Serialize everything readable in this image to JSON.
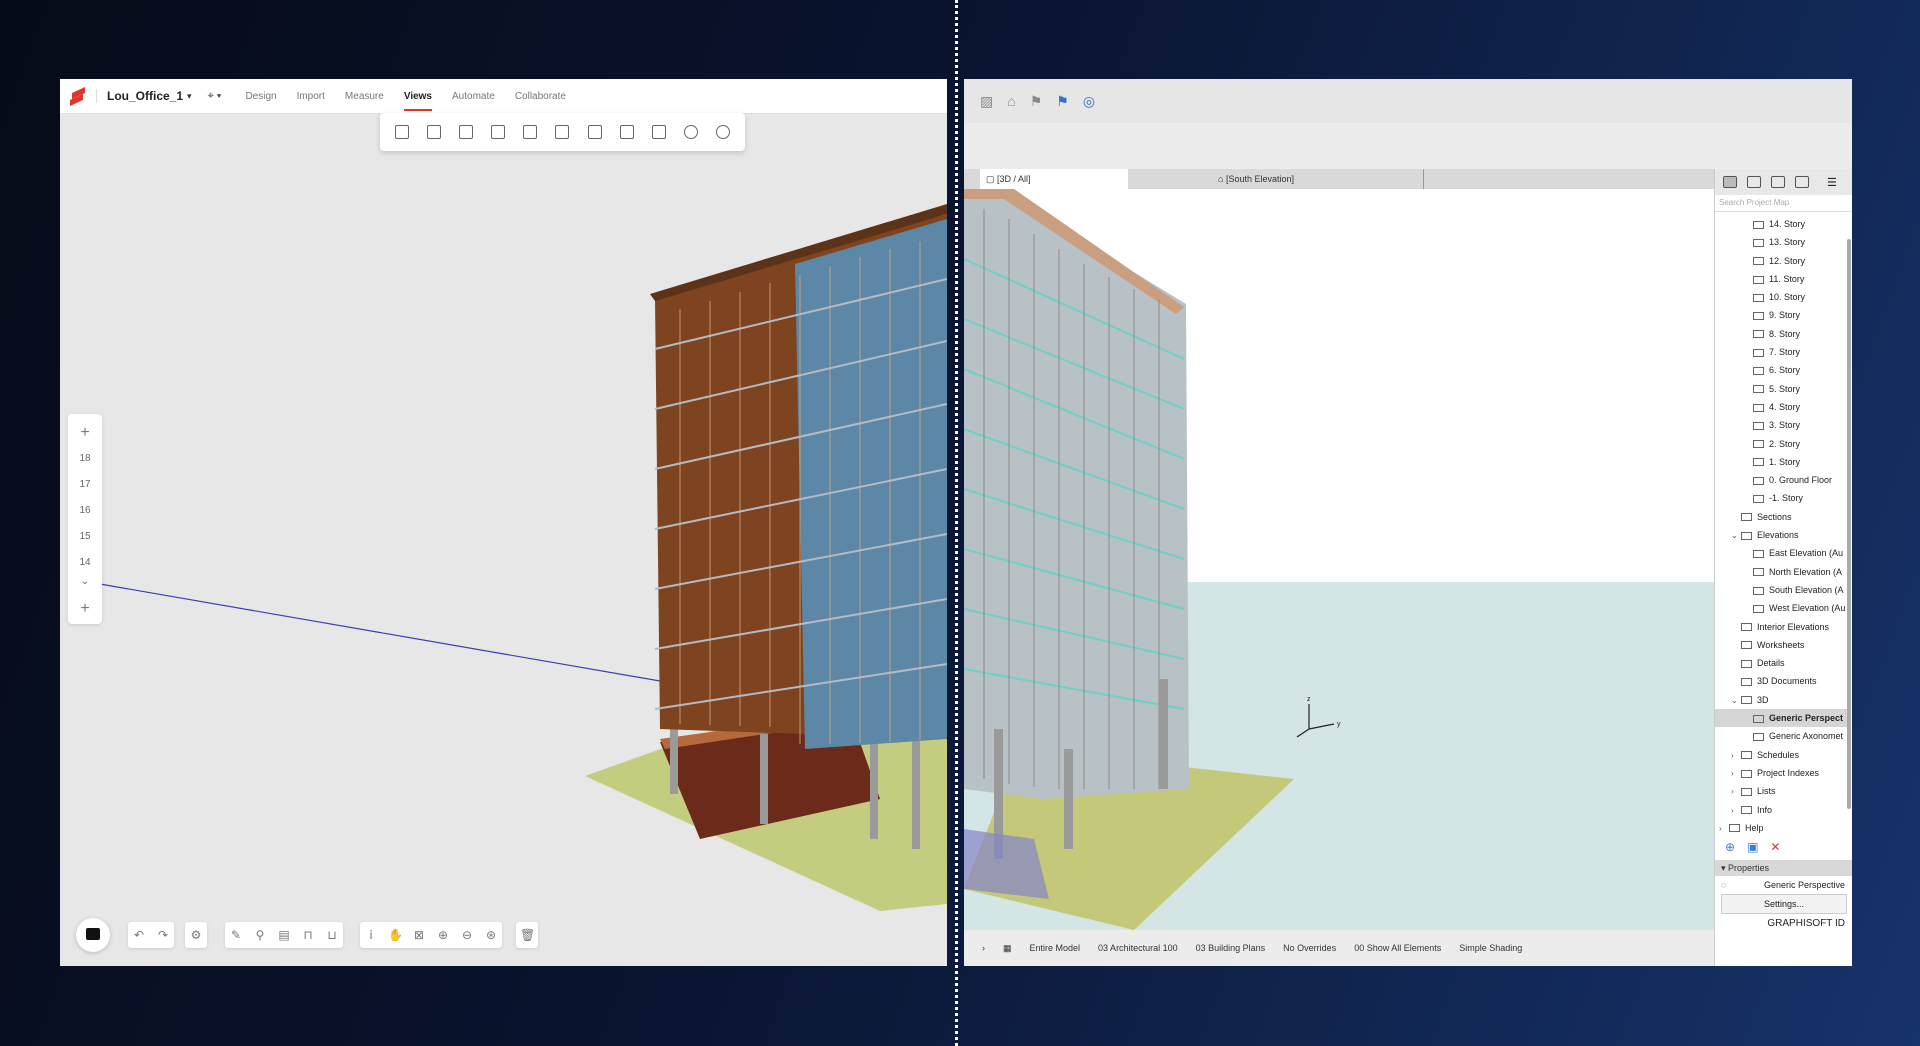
{
  "left_app": {
    "project_name": "Lou_Office_1",
    "nav_tabs": [
      "Design",
      "Import",
      "Measure",
      "Views",
      "Automate",
      "Collaborate"
    ],
    "active_tab": "Views",
    "story_levels": [
      "18",
      "17",
      "16",
      "15",
      "14"
    ]
  },
  "right_app": {
    "tab_3d": "[3D / All]",
    "tab_elevation": "[South Elevation]",
    "search_placeholder": "Search Project Map",
    "tree": [
      {
        "label": "14. Story",
        "indent": 2,
        "type": "story"
      },
      {
        "label": "13. Story",
        "indent": 2,
        "type": "story"
      },
      {
        "label": "12. Story",
        "indent": 2,
        "type": "story"
      },
      {
        "label": "11. Story",
        "indent": 2,
        "type": "story"
      },
      {
        "label": "10. Story",
        "indent": 2,
        "type": "story"
      },
      {
        "label": "9. Story",
        "indent": 2,
        "type": "story"
      },
      {
        "label": "8. Story",
        "indent": 2,
        "type": "story"
      },
      {
        "label": "7. Story",
        "indent": 2,
        "type": "story"
      },
      {
        "label": "6. Story",
        "indent": 2,
        "type": "story"
      },
      {
        "label": "5. Story",
        "indent": 2,
        "type": "story"
      },
      {
        "label": "4. Story",
        "indent": 2,
        "type": "story"
      },
      {
        "label": "3. Story",
        "indent": 2,
        "type": "story"
      },
      {
        "label": "2. Story",
        "indent": 2,
        "type": "story"
      },
      {
        "label": "1. Story",
        "indent": 2,
        "type": "story"
      },
      {
        "label": "0. Ground Floor",
        "indent": 2,
        "type": "story"
      },
      {
        "label": "-1. Story",
        "indent": 2,
        "type": "story"
      },
      {
        "label": "Sections",
        "indent": 1,
        "type": "folder"
      },
      {
        "label": "Elevations",
        "indent": 1,
        "type": "folder",
        "expanded": true
      },
      {
        "label": "East Elevation (Au",
        "indent": 2,
        "type": "view"
      },
      {
        "label": "North Elevation (A",
        "indent": 2,
        "type": "view"
      },
      {
        "label": "South Elevation (A",
        "indent": 2,
        "type": "view"
      },
      {
        "label": "West Elevation (Au",
        "indent": 2,
        "type": "view"
      },
      {
        "label": "Interior Elevations",
        "indent": 1,
        "type": "folder"
      },
      {
        "label": "Worksheets",
        "indent": 1,
        "type": "folder"
      },
      {
        "label": "Details",
        "indent": 1,
        "type": "folder"
      },
      {
        "label": "3D Documents",
        "indent": 1,
        "type": "folder"
      },
      {
        "label": "3D",
        "indent": 1,
        "type": "folder",
        "expanded": true
      },
      {
        "label": "Generic Perspect",
        "indent": 2,
        "type": "view",
        "selected": true
      },
      {
        "label": "Generic Axonomet",
        "indent": 2,
        "type": "view"
      },
      {
        "label": "Schedules",
        "indent": 1,
        "type": "folder",
        "collapsed": true
      },
      {
        "label": "Project Indexes",
        "indent": 1,
        "type": "folder",
        "collapsed": true
      },
      {
        "label": "Lists",
        "indent": 1,
        "type": "folder",
        "collapsed": true
      },
      {
        "label": "Info",
        "indent": 1,
        "type": "folder",
        "collapsed": true
      },
      {
        "label": "Help",
        "indent": 0,
        "type": "folder",
        "collapsed": true
      }
    ],
    "properties_label": "Properties",
    "properties_value": "Generic Perspective",
    "settings_label": "Settings...",
    "brand": "GRAPHISOFT ID",
    "status": {
      "model": "Entire Model",
      "layer": "03 Architectural 100",
      "plans": "03 Building Plans",
      "overrides": "No Overrides",
      "elements": "00 Show All Elements",
      "shading": "Simple Shading"
    },
    "axis_labels": [
      "z",
      "y"
    ]
  },
  "colors": {
    "accent_red": "#e0362c",
    "timber": "#8a4a22",
    "glass": "#5d87a6",
    "ground": "#c4cd7f"
  }
}
